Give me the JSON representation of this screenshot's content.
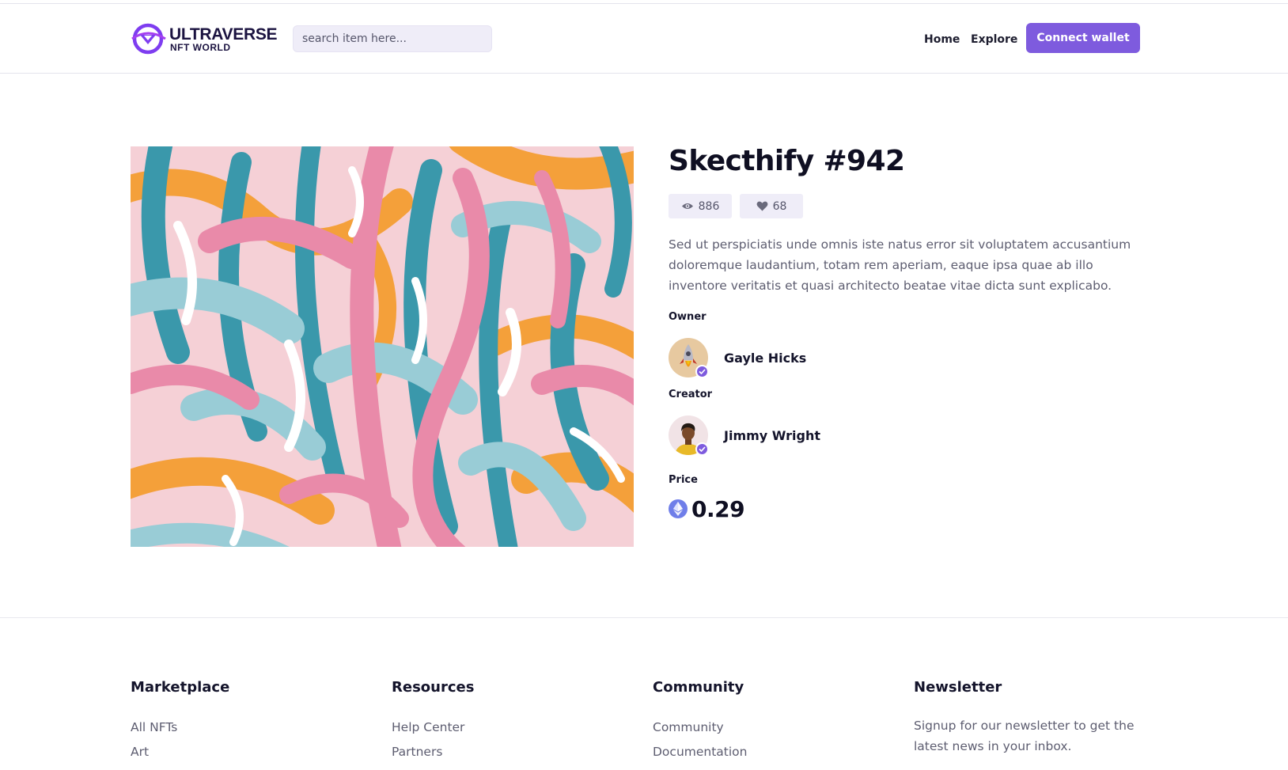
{
  "header": {
    "brand_line1": "ULTRAVERSE",
    "brand_line2": "NFT WORLD",
    "search_placeholder": "search item here...",
    "nav": {
      "home": "Home",
      "explore": "Explore"
    },
    "connect_label": "Connect wallet"
  },
  "item": {
    "title": "Skecthify #942",
    "views": "886",
    "likes": "68",
    "description": "Sed ut perspiciatis unde omnis iste natus error sit voluptatem accusantium doloremque laudantium, totam rem aperiam, eaque ipsa quae ab illo inventore veritatis et quasi architecto beatae vitae dicta sunt explicabo.",
    "owner_label": "Owner",
    "owner_name": "Gayle Hicks",
    "creator_label": "Creator",
    "creator_name": "Jimmy Wright",
    "price_label": "Price",
    "price_value": "0.29",
    "price_currency_icon": "ethereum-icon"
  },
  "footer": {
    "marketplace": {
      "heading": "Marketplace",
      "links": [
        "All NFTs",
        "Art"
      ]
    },
    "resources": {
      "heading": "Resources",
      "links": [
        "Help Center",
        "Partners"
      ]
    },
    "community": {
      "heading": "Community",
      "links": [
        "Community",
        "Documentation"
      ]
    },
    "newsletter": {
      "heading": "Newsletter",
      "text": "Signup for our newsletter to get the latest news in your inbox."
    }
  },
  "colors": {
    "accent": "#7e5bde",
    "input_bg": "#efedf8",
    "eth": "#6f7ee9",
    "art_palette": [
      "#f5d0d6",
      "#3a98ab",
      "#f4a03a",
      "#e98aa9",
      "#99ccd6",
      "#ffffff"
    ]
  }
}
